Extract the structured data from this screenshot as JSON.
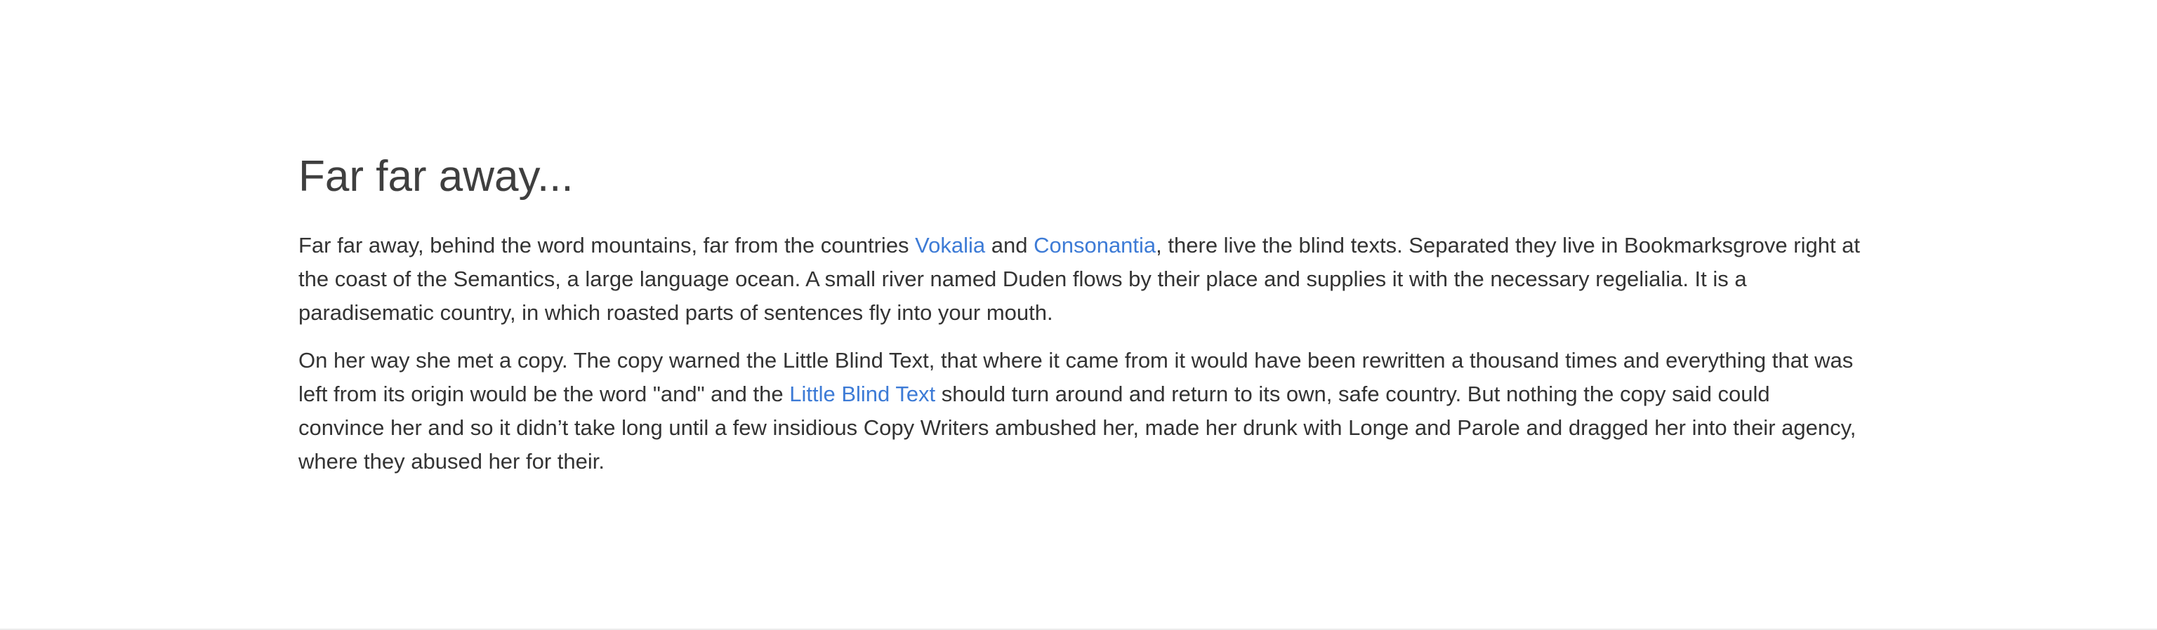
{
  "article": {
    "title": "Far far away...",
    "para1": {
      "t1": "Far far away, behind the word mountains, far from the countries ",
      "link1": "Vokalia",
      "t2": " and ",
      "link2": "Consonantia",
      "t3": ", there live the blind texts. Separated they live in Bookmarksgrove right at the coast of the Semantics, a large language ocean. A small river named Duden flows by their place and supplies it with the necessary regelialia. It is a paradisematic country, in which roasted parts of sentences fly into your mouth."
    },
    "para2": {
      "t1": "On her way she met a copy. The copy warned the Little Blind Text, that where it came from it would have been rewritten a thousand times and everything that was left from its origin would be the word \"and\" and the ",
      "link1": "Little Blind Text",
      "t2": " should turn around and return to its own, safe country. But nothing the copy said could convince her and so it didn’t take long until a few insidious Copy Writers ambushed her, made her drunk with Longe and Parole and dragged her into their agency, where they abused her for their."
    }
  },
  "colors": {
    "text": "#333333",
    "heading": "#3f3f3f",
    "link": "#3d7bd6",
    "background": "#ffffff"
  }
}
